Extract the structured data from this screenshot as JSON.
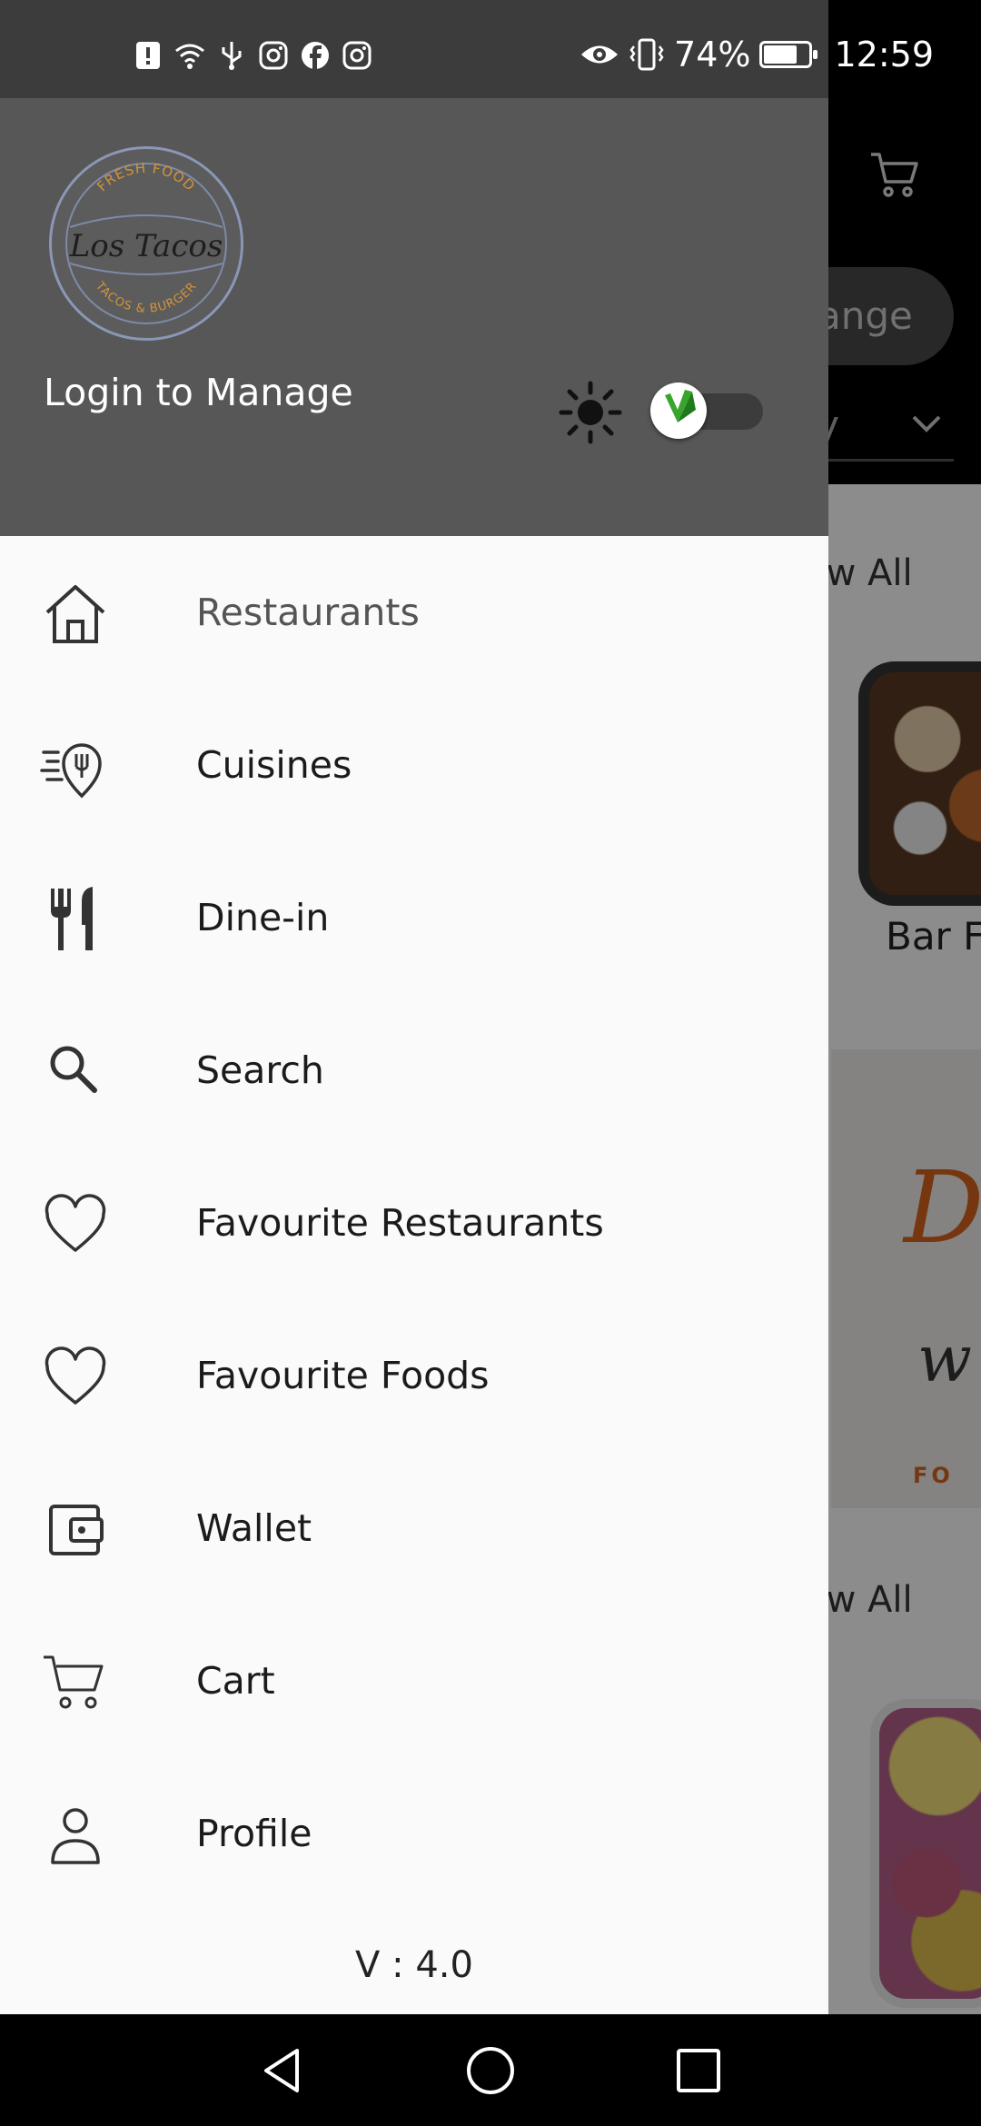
{
  "status_bar": {
    "left_icons": [
      "alert-icon",
      "wifi-icon",
      "usb-icon",
      "instagram-icon",
      "facebook-icon",
      "instagram-icon"
    ],
    "eye_icon": "eye-icon",
    "vibrate_icon": "vibrate-icon",
    "battery_percent": "74%",
    "battery_level": 0.74,
    "time": "12:59"
  },
  "drawer": {
    "logo": {
      "top_text": "FRESH FOOD",
      "main_text": "Los Tacos",
      "bottom_text": "TACOS & BURGER"
    },
    "login_label": "Login to Manage",
    "theme_icon": "sun-icon",
    "theme_toggle_on": false,
    "menu": [
      {
        "label": "Restaurants",
        "icon": "home-icon",
        "active": true
      },
      {
        "label": "Cuisines",
        "icon": "cuisine-location-icon"
      },
      {
        "label": "Dine-in",
        "icon": "fork-knife-icon"
      },
      {
        "label": "Search",
        "icon": "search-icon"
      },
      {
        "label": "Favourite Restaurants",
        "icon": "heart-icon"
      },
      {
        "label": "Favourite Foods",
        "icon": "heart-icon"
      },
      {
        "label": "Wallet",
        "icon": "wallet-icon"
      },
      {
        "label": "Cart",
        "icon": "cart-icon"
      },
      {
        "label": "Profile",
        "icon": "person-icon"
      }
    ],
    "version": "V : 4.0"
  },
  "background": {
    "change_button": "ange",
    "dropdown_text": "ry",
    "view_all_1": "ew All",
    "view_all_2": "ew All",
    "restaurant_label": "Bar Fo",
    "promo_text_1": "D",
    "promo_text_2": "w",
    "promo_text_3": "FO"
  },
  "nav_bar": {
    "back": "back-triangle-icon",
    "home": "home-circle-icon",
    "recents": "recents-square-icon"
  },
  "colors": {
    "drawer_header": "#575757",
    "drawer_body": "#fafafa",
    "status_bar": "#3c3c3c",
    "logo_accent": "#d4943a",
    "toggle_green": "#3aa52d"
  }
}
